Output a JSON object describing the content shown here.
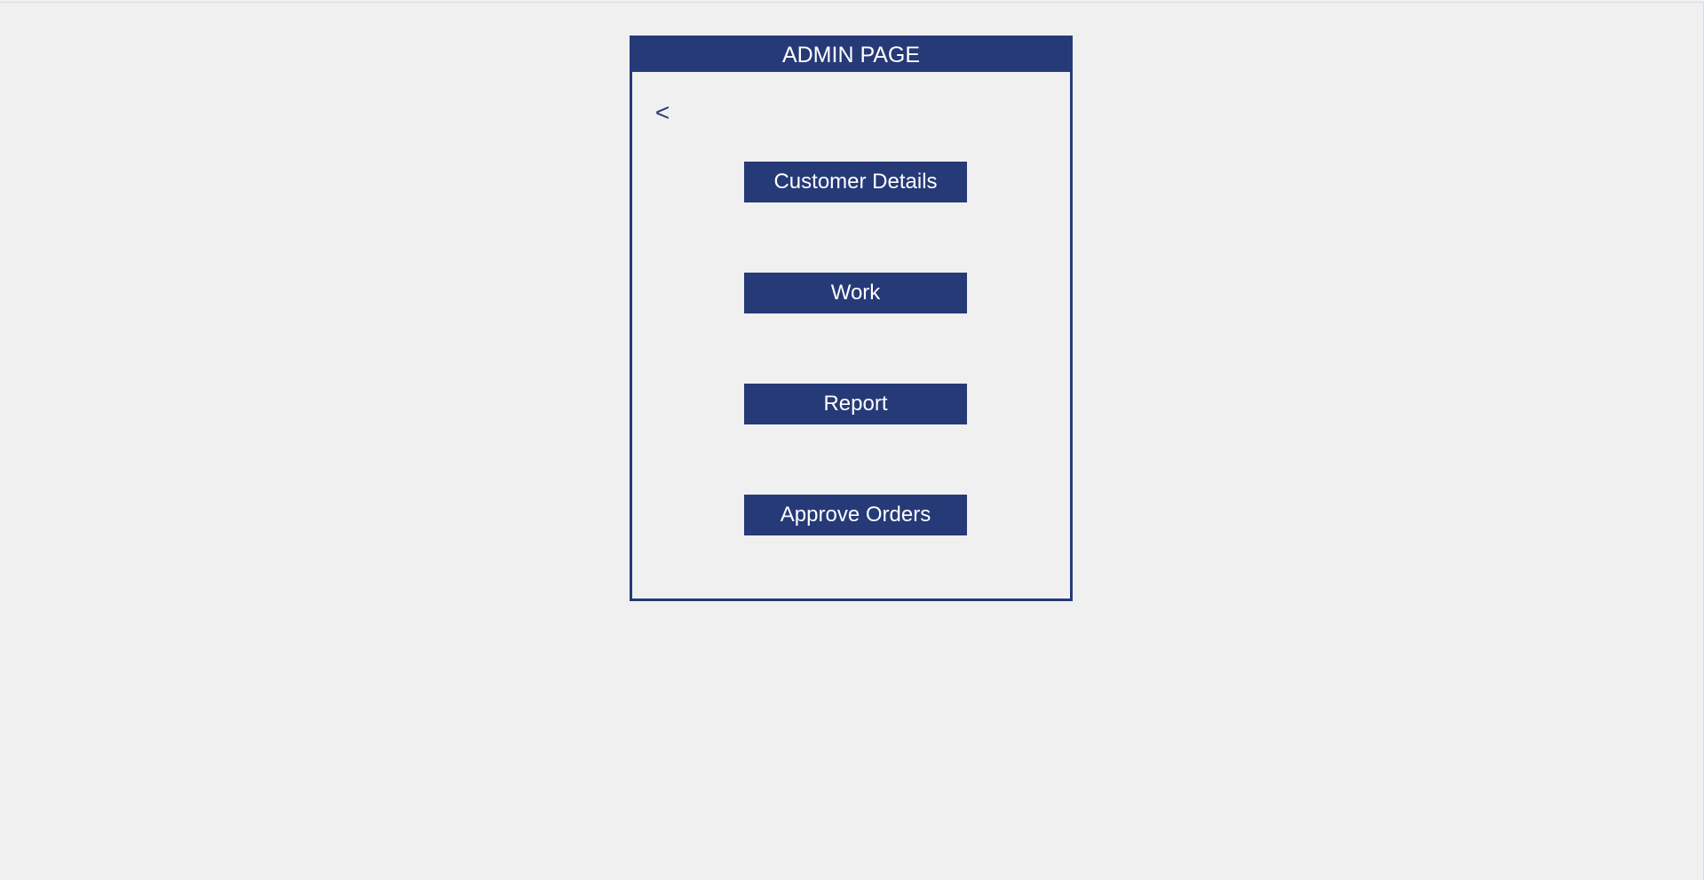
{
  "header": {
    "title": "ADMIN PAGE"
  },
  "nav": {
    "back_label": "<",
    "back_icon": "chevron-left-icon"
  },
  "menu": {
    "items": [
      {
        "label": "Customer Details"
      },
      {
        "label": "Work"
      },
      {
        "label": "Report"
      },
      {
        "label": "Approve Orders"
      }
    ]
  },
  "colors": {
    "accent": "#263a78",
    "background": "#f0f0f0",
    "button_text": "#ffffff"
  }
}
